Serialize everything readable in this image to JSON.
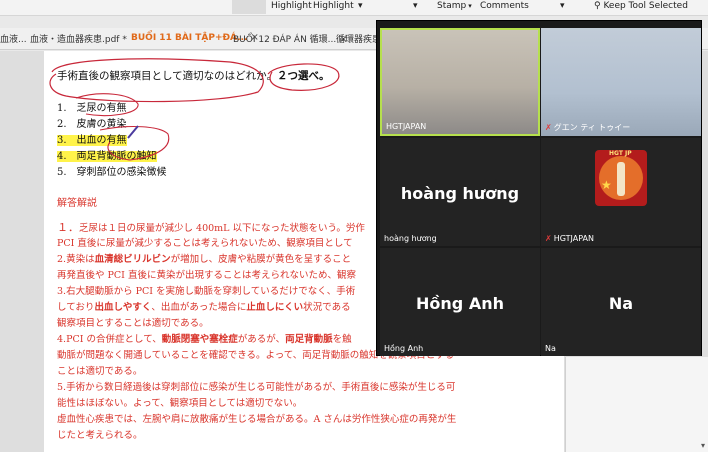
{
  "ribbon": {
    "highlight_1": "Highlight",
    "highlight_2": "Highlight",
    "stamp": "Stamp",
    "comments": "Comments",
    "keep_tool": "Keep Tool Selected",
    "caret": "▾"
  },
  "tabs": [
    {
      "label": "血液..."
    },
    {
      "label": "血液・造血器疾患.pdf *"
    },
    {
      "label": "BUỔI 11 BÀI TẬP+ĐÁ..."
    },
    {
      "label": "BUỔI 12 ĐÁP ÁN 循環..."
    },
    {
      "label": "循環器疾患"
    }
  ],
  "tab_close": "×",
  "question": {
    "text": "手術直後の観察項目として適切なのはどれか。",
    "strong": "２つ選べ。"
  },
  "options": [
    {
      "num": "1.",
      "text": "乏尿の有無"
    },
    {
      "num": "2.",
      "text": "皮膚の黄染"
    },
    {
      "num": "3.",
      "text": "出血の有無"
    },
    {
      "num": "4.",
      "text": "両足背動脈の触知"
    },
    {
      "num": "5.",
      "text": "穿刺部位の感染徴候"
    }
  ],
  "answer_title": "解答解説",
  "answer_lines": {
    "l1a": "１．",
    "l1b": "乏尿は１日の尿量が減少し 400mL 以下になった状態をいう。労作",
    "l2": "PCI 直後に尿量が減少することは考えられないため、観察項目として",
    "l3a": "2.黄染は",
    "l3b": "血清総ビリルビン",
    "l3c": "が増加し、皮膚や粘膜が黄色を呈すること",
    "l4": "再発直後や PCI 直後に黄染が出現することは考えられないため、観察",
    "l5": "3.右大腿動脈から PCI を実施し動脈を穿刺しているだけでなく、手術",
    "l6a": "しており",
    "l6b": "出血しやすく",
    "l6c": "、出血があった場合に",
    "l6d": "止血しにくい",
    "l6e": "状況である",
    "l7": "観察項目とすることは適切である。",
    "l8a": "4.PCI の合併症として、",
    "l8b": "動脈閉塞や塞栓症",
    "l8c": "があるが、",
    "l8d": "両足背動脈",
    "l8e": "を触",
    "l9": "動脈が問題なく開通していることを確認できる。よって、両足背動脈の触知を観察項目とする",
    "l10": "ことは適切である。",
    "l11": "5.手術から数日経過後は穿刺部位に感染が生じる可能性があるが、手術直後に感染が生じる可",
    "l12": "能性はほぼない。よって、観察項目としては適切でない。",
    "l13": "虚血性心疾患では、左腕や肩に放散痛が生じる場合がある。A さんは労作性狭心症の再発が生",
    "l14": "じたと考えられる。"
  },
  "video": {
    "tiles": [
      {
        "name": "HGTJAPAN"
      },
      {
        "name": "グエン ティ トゥイー"
      },
      {
        "display": "hoàng hương",
        "name": "hoàng hương"
      },
      {
        "name": "HGTJAPAN",
        "logo_text": "HGT JP"
      },
      {
        "display": "Hồng Anh",
        "name": "Hồng Anh"
      },
      {
        "display": "Na",
        "name": "Na"
      }
    ]
  },
  "colors": {
    "highlight": "#fff34a",
    "answer_red": "#d9352c",
    "active_tab": "#e06a1a",
    "speaker_border": "#b6e04d"
  }
}
